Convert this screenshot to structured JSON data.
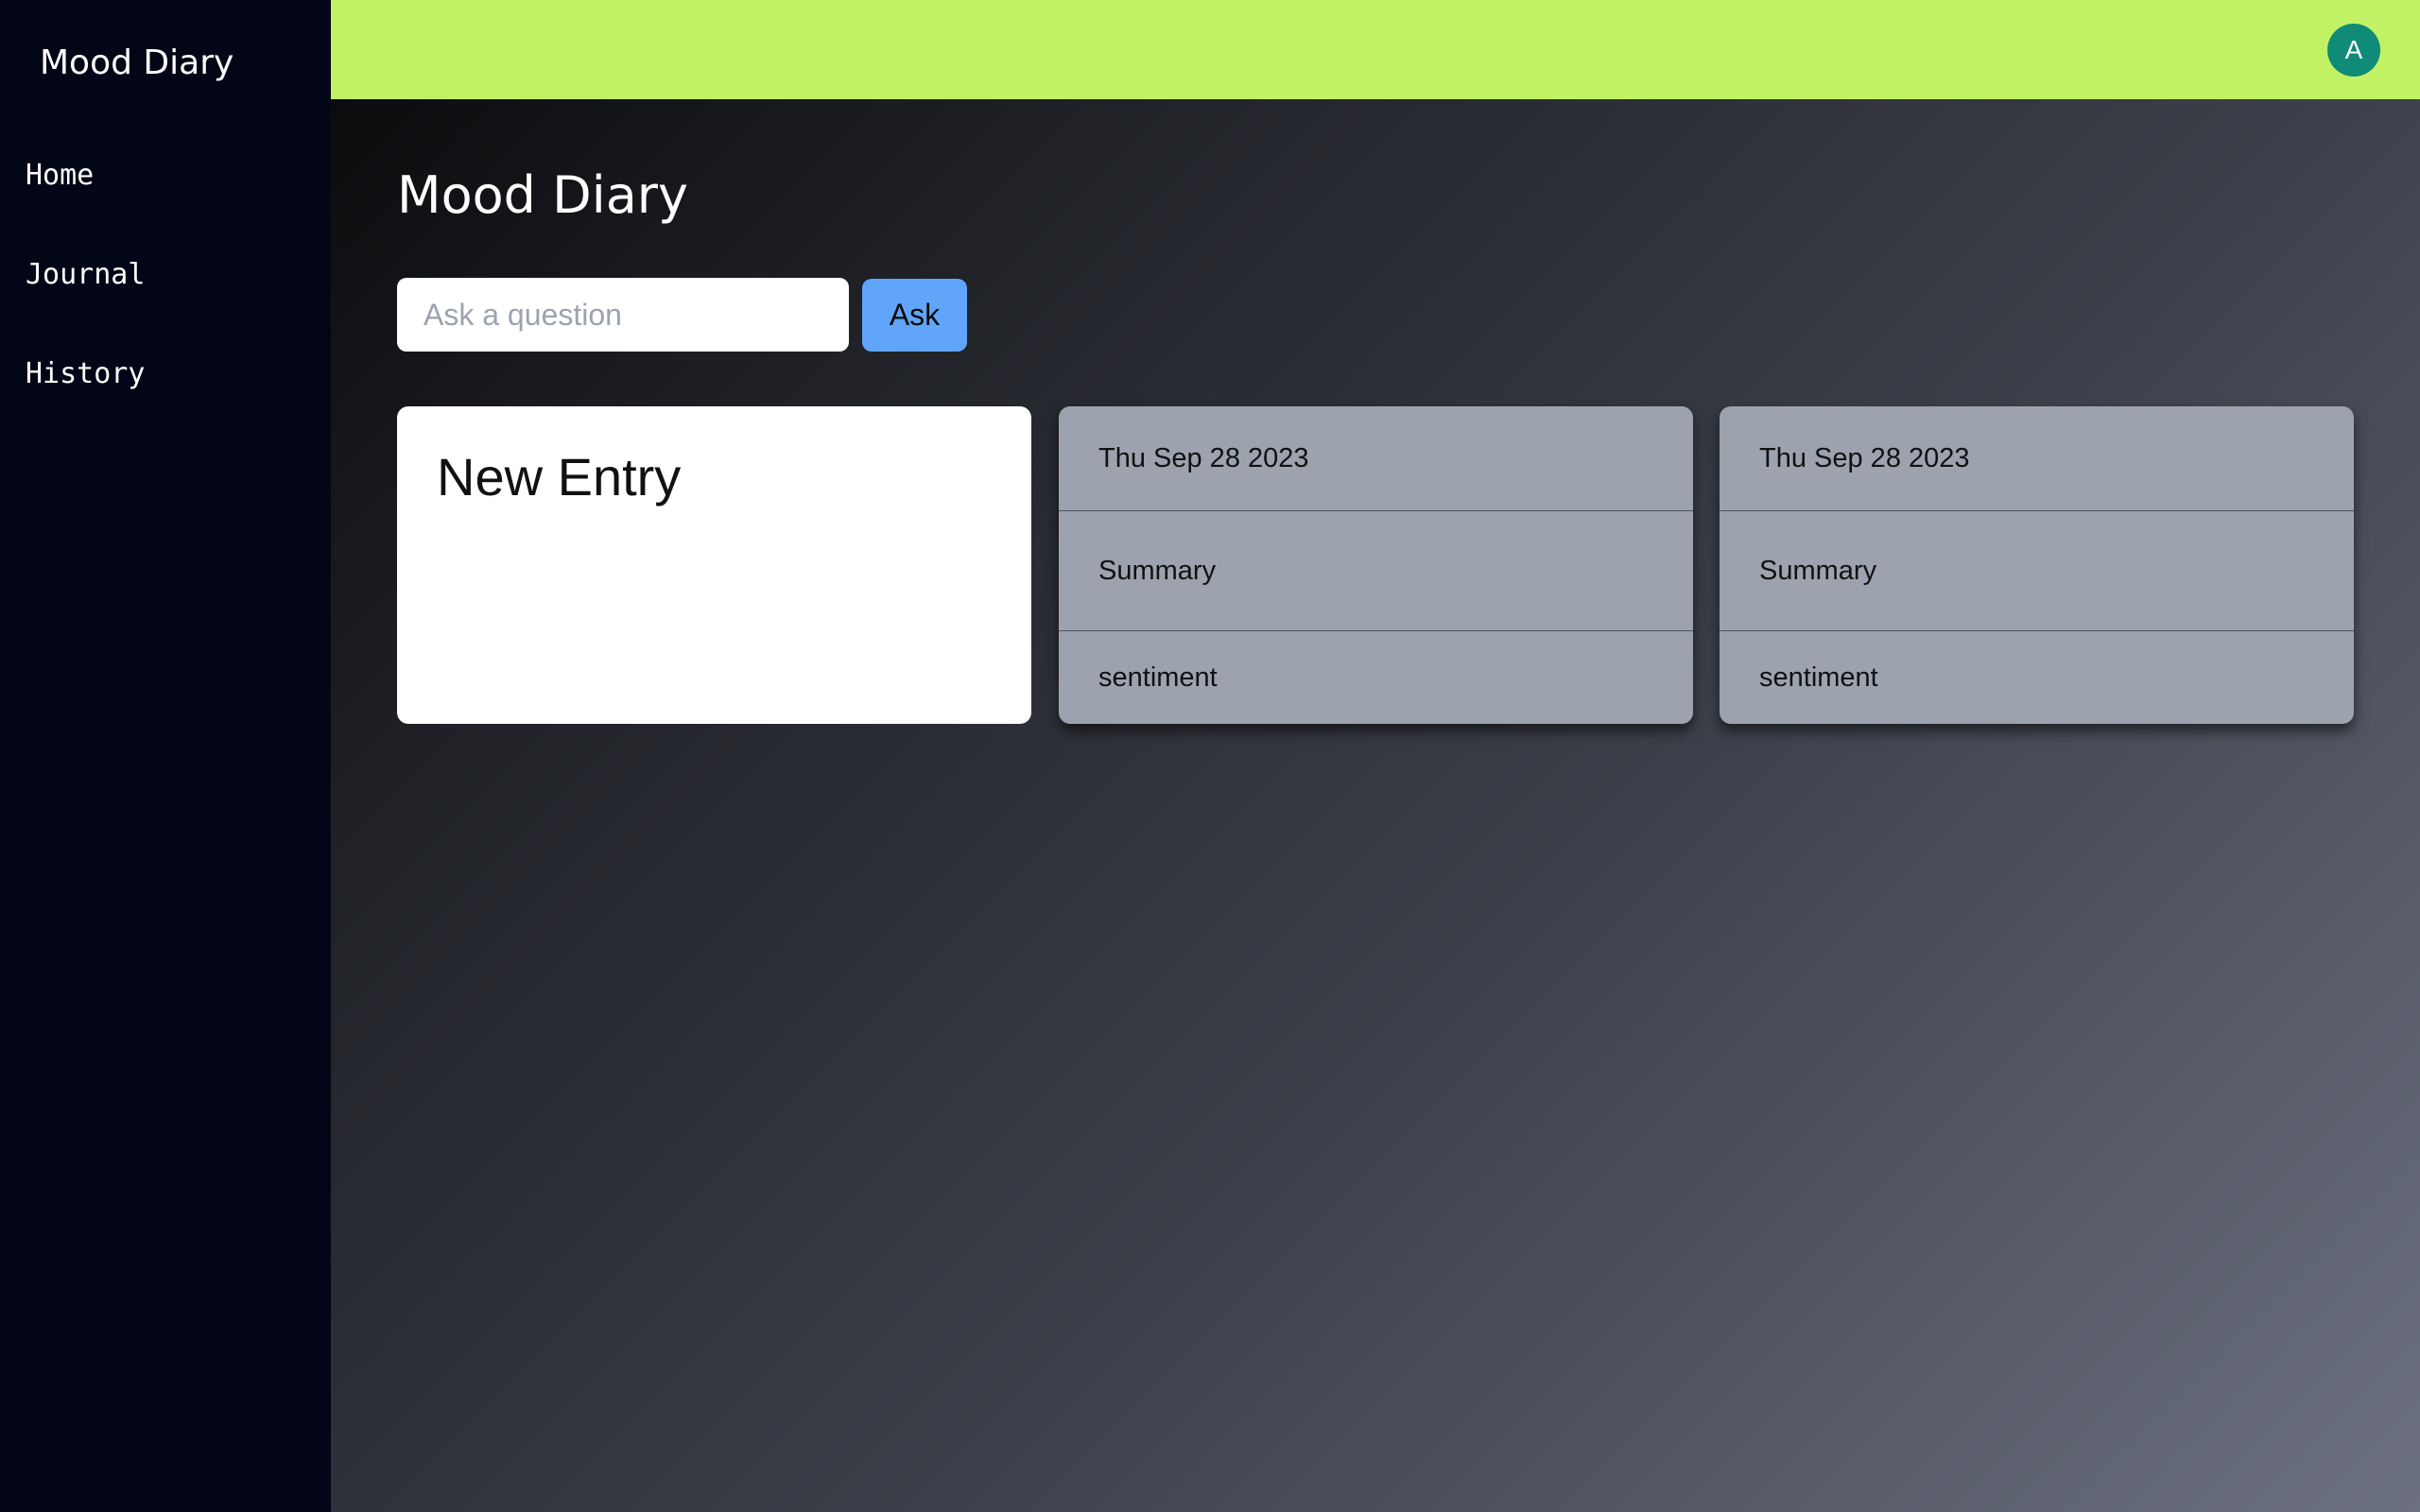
{
  "sidebar": {
    "brand": "Mood Diary",
    "items": [
      {
        "label": "Home"
      },
      {
        "label": "Journal"
      },
      {
        "label": "History"
      }
    ]
  },
  "header": {
    "avatar_initial": "A"
  },
  "main": {
    "title": "Mood Diary",
    "ask": {
      "placeholder": "Ask a question",
      "value": "",
      "button_label": "Ask"
    },
    "new_entry_label": "New Entry",
    "entries": [
      {
        "date": "Thu Sep 28 2023",
        "summary": "Summary",
        "sentiment": "sentiment"
      },
      {
        "date": "Thu Sep 28 2023",
        "summary": "Summary",
        "sentiment": "sentiment"
      }
    ]
  },
  "colors": {
    "sidebar_bg": "#030617",
    "header_bg": "#c1f266",
    "avatar_bg": "#0f8b78",
    "ask_button_bg": "#60a5fa",
    "entry_card_bg": "#9ca3af"
  }
}
